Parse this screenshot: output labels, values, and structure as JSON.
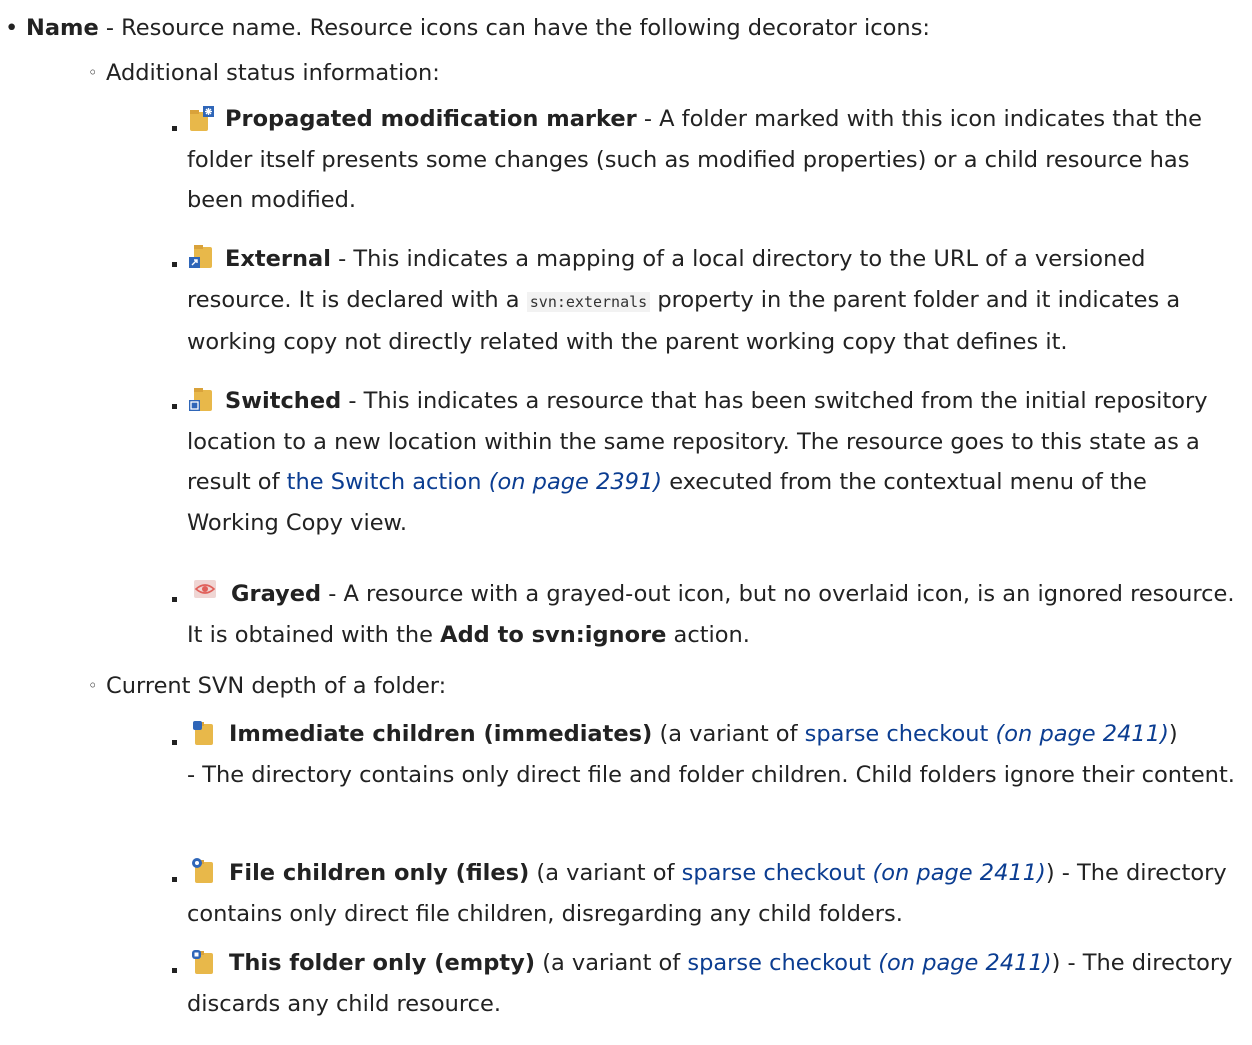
{
  "name_item": {
    "bullet": "•",
    "term": "Name",
    "text": " - Resource name. Resource icons can have the following decorator icons:"
  },
  "sections": [
    {
      "bullet": "◦",
      "label": "Additional status information:"
    },
    {
      "bullet": "◦",
      "label": "Current SVN depth of a folder:"
    }
  ],
  "status_items": {
    "propagated": {
      "icon": "propagated-modification-icon",
      "term": "Propagated modification marker",
      "text": " - A folder marked with this icon indicates that the folder itself presents some changes (such as modified properties) or a child resource has been modified."
    },
    "external": {
      "icon": "external-icon",
      "term": "External",
      "text_before_code": " - This indicates a mapping of a local directory to the URL of a versioned resource. It is declared with a ",
      "code": "svn:externals",
      "text_after_code": " property in the parent folder and it indicates a working copy not directly related with the parent working copy that defines it."
    },
    "switched": {
      "icon": "switched-icon",
      "term": "Switched",
      "text_before_link": " - This indicates a resource that has been switched from the initial repository location to a new location within the same repository. The resource goes to this state as a result of ",
      "link": "the Switch action",
      "pageref": "(on page 2391)",
      "text_after_link": " executed from the contextual menu of the Working Copy view."
    },
    "grayed": {
      "icon": "grayed-icon",
      "term": "Grayed",
      "text_before_bold": " - A resource with a grayed-out icon, but no overlaid icon, is an ignored resource. It is obtained with the ",
      "bold": "Add to svn:ignore",
      "text_after_bold": " action."
    }
  },
  "depth_items": {
    "immediates": {
      "icon": "immediates-folder-icon",
      "term": "Immediate children (immediates)",
      "text_before_link": " (a variant of ",
      "link": "sparse checkout",
      "pageref": "(on page 2411)",
      "text_after_link": ")",
      "text_continued": "- The directory contains only direct file and folder children. Child folders ignore their content."
    },
    "files": {
      "icon": "files-folder-icon",
      "term": "File children only (files)",
      "text_before_link": " (a variant of ",
      "link": "sparse checkout",
      "pageref": "(on page 2411)",
      "text_after_link": ") - The directory contains only direct file children, disregarding any child folders."
    },
    "empty": {
      "icon": "empty-folder-icon",
      "term": "This folder only (empty)",
      "text_before_link": " (a variant of ",
      "link": "sparse checkout",
      "pageref": "(on page 2411)",
      "text_after_link": ") - The directory discards any child resource."
    }
  },
  "colors": {
    "text": "#222222",
    "link": "#0b3d91",
    "folder": "#e8b84a",
    "overlay_blue": "#2f66b8",
    "grayed_red": "#e0605a"
  }
}
